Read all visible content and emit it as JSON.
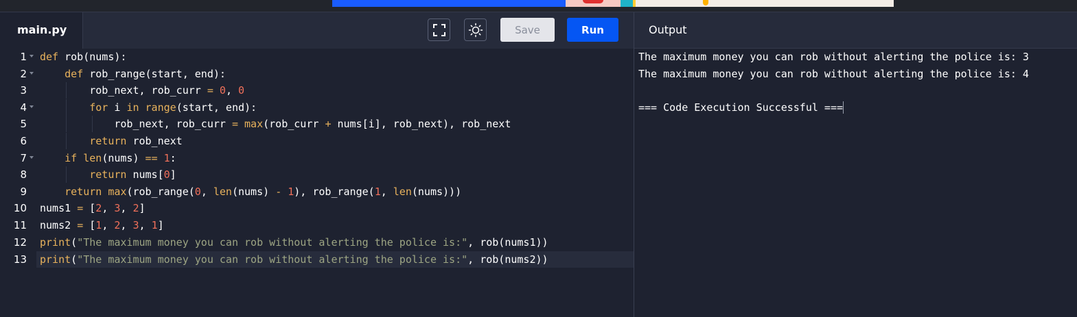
{
  "editor": {
    "tab_label": "main.py",
    "save_label": "Save",
    "run_label": "Run",
    "fullscreen_icon": "fullscreen-icon",
    "theme_icon": "sun-icon"
  },
  "output": {
    "title": "Output",
    "lines": [
      "The maximum money you can rob without alerting the police is: 3",
      "The maximum money you can rob without alerting the police is: 4",
      "",
      "=== Code Execution Successful ==="
    ]
  },
  "code": {
    "line_numbers": [
      "1",
      "2",
      "3",
      "4",
      "5",
      "6",
      "7",
      "8",
      "9",
      "10",
      "11",
      "12",
      "13"
    ],
    "lines": [
      "def rob(nums):",
      "    def rob_range(start, end):",
      "        rob_next, rob_curr = 0, 0",
      "        for i in range(start, end):",
      "            rob_next, rob_curr = max(rob_curr + nums[i], rob_next), rob_next",
      "        return rob_next",
      "    if len(nums) == 1:",
      "        return nums[0]",
      "    return max(rob_range(0, len(nums) - 1), rob_range(1, len(nums)))",
      "nums1 = [2, 3, 2]",
      "nums2 = [1, 2, 3, 1]",
      "print(\"The maximum money you can rob without alerting the police is:\", rob(nums1))",
      "print(\"The maximum money you can rob without alerting the police is:\", rob(nums2))"
    ]
  },
  "colors": {
    "run_button": "#0556f3",
    "keyword": "#e8b25c",
    "number": "#f0705a",
    "string": "#9da583",
    "background": "#1e2230"
  }
}
